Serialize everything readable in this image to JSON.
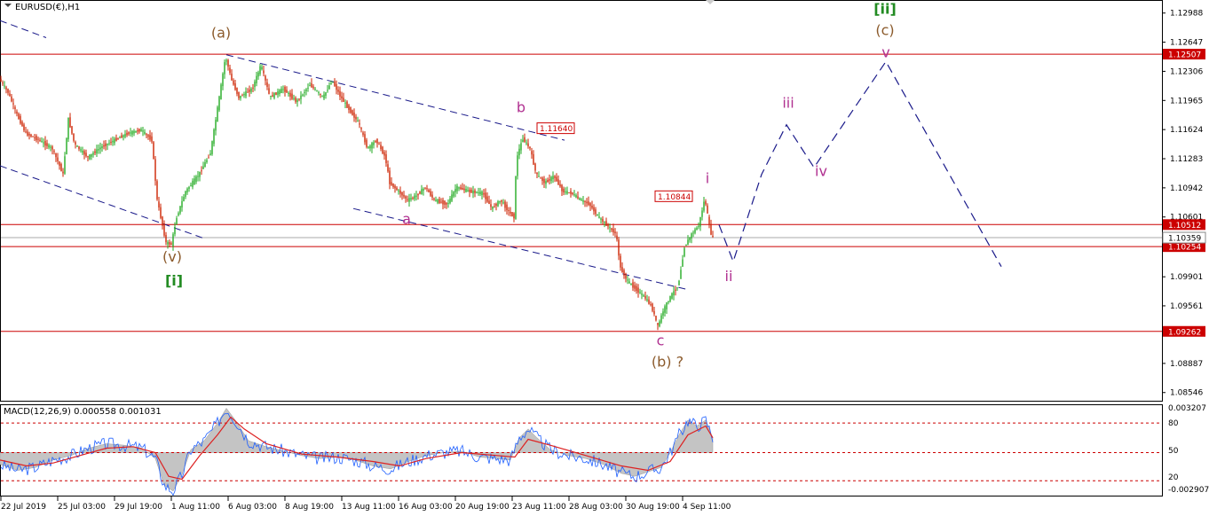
{
  "window": {
    "title": "EURUSD(€),H1"
  },
  "chart_data": [
    {
      "type": "line",
      "title": "EURUSD(€),H1",
      "ylim": [
        1.0845,
        1.1312
      ],
      "y_ticks": [
        "1.12988",
        "1.12647",
        "1.12306",
        "1.11965",
        "1.11624",
        "1.11283",
        "1.10942",
        "1.10601",
        "1.09901",
        "1.09561",
        "1.08887",
        "1.08546"
      ],
      "x_ticks": [
        "22 Jul 2019",
        "25 Jul 03:00",
        "29 Jul 19:00",
        "1 Aug 11:00",
        "6 Aug 03:00",
        "8 Aug 19:00",
        "13 Aug 11:00",
        "16 Aug 03:00",
        "20 Aug 19:00",
        "23 Aug 11:00",
        "28 Aug 03:00",
        "30 Aug 19:00",
        "4 Sep 11:00"
      ],
      "price_path": [
        [
          0,
          1.1222
        ],
        [
          10,
          1.1206
        ],
        [
          20,
          1.118
        ],
        [
          30,
          1.1158
        ],
        [
          45,
          1.115
        ],
        [
          60,
          1.114
        ],
        [
          72,
          1.111
        ],
        [
          78,
          1.1175
        ],
        [
          85,
          1.1145
        ],
        [
          100,
          1.113
        ],
        [
          115,
          1.1142
        ],
        [
          130,
          1.115
        ],
        [
          145,
          1.1158
        ],
        [
          160,
          1.1162
        ],
        [
          172,
          1.115
        ],
        [
          178,
          1.108
        ],
        [
          182,
          1.106
        ],
        [
          188,
          1.103
        ],
        [
          194,
          1.1028
        ],
        [
          200,
          1.106
        ],
        [
          210,
          1.109
        ],
        [
          225,
          1.111
        ],
        [
          238,
          1.1135
        ],
        [
          248,
          1.12
        ],
        [
          255,
          1.1248
        ],
        [
          262,
          1.122
        ],
        [
          270,
          1.12
        ],
        [
          285,
          1.121
        ],
        [
          295,
          1.1238
        ],
        [
          305,
          1.12
        ],
        [
          320,
          1.121
        ],
        [
          335,
          1.1195
        ],
        [
          350,
          1.1215
        ],
        [
          365,
          1.12
        ],
        [
          375,
          1.122
        ],
        [
          385,
          1.12
        ],
        [
          395,
          1.1185
        ],
        [
          405,
          1.117
        ],
        [
          415,
          1.114
        ],
        [
          425,
          1.115
        ],
        [
          435,
          1.113
        ],
        [
          440,
          1.11
        ],
        [
          450,
          1.109
        ],
        [
          460,
          1.108
        ],
        [
          470,
          1.1085
        ],
        [
          480,
          1.1095
        ],
        [
          490,
          1.108
        ],
        [
          505,
          1.1075
        ],
        [
          515,
          1.1095
        ],
        [
          530,
          1.109
        ],
        [
          545,
          1.1088
        ],
        [
          555,
          1.107
        ],
        [
          565,
          1.108
        ],
        [
          575,
          1.1065
        ],
        [
          580,
          1.106
        ],
        [
          583,
          1.113
        ],
        [
          590,
          1.1152
        ],
        [
          598,
          1.114
        ],
        [
          605,
          1.111
        ],
        [
          615,
          1.11
        ],
        [
          625,
          1.1108
        ],
        [
          635,
          1.109
        ],
        [
          645,
          1.1088
        ],
        [
          655,
          1.108
        ],
        [
          665,
          1.1075
        ],
        [
          675,
          1.106
        ],
        [
          685,
          1.105
        ],
        [
          695,
          1.104
        ],
        [
          700,
          1.1
        ],
        [
          708,
          1.0985
        ],
        [
          718,
          1.0975
        ],
        [
          728,
          1.0965
        ],
        [
          735,
          1.0955
        ],
        [
          742,
          1.0932
        ],
        [
          748,
          1.095
        ],
        [
          755,
          1.0965
        ],
        [
          765,
          1.098
        ],
        [
          772,
          1.1025
        ],
        [
          780,
          1.104
        ],
        [
          788,
          1.105
        ],
        [
          795,
          1.1082
        ],
        [
          800,
          1.105
        ],
        [
          803,
          1.1036
        ]
      ],
      "horizontal_levels": [
        {
          "value": 1.12507,
          "label": "1.12507",
          "color": "#cc0000"
        },
        {
          "value": 1.10512,
          "label": "1.10512",
          "color": "#cc0000"
        },
        {
          "value": 1.10254,
          "label": "1.10254",
          "color": "#cc0000"
        },
        {
          "value": 1.09262,
          "label": "1.09262",
          "color": "#cc0000"
        }
      ],
      "current_price": {
        "value": 1.10359,
        "label": "1.10359",
        "color": "#aaaaaa"
      },
      "price_boxes": [
        {
          "label": "1.11640",
          "x": 605,
          "y": 1.1164
        },
        {
          "label": "1.10844",
          "x": 738,
          "y": 1.10844
        }
      ],
      "trendlines": [
        {
          "x1": 0,
          "y1": 1.129,
          "x2": 52,
          "y2": 1.127
        },
        {
          "x1": 0,
          "y1": 1.112,
          "x2": 230,
          "y2": 1.1035
        },
        {
          "x1": 255,
          "y1": 1.125,
          "x2": 636,
          "y2": 1.115
        },
        {
          "x1": 398,
          "y1": 1.107,
          "x2": 775,
          "y2": 1.0975
        }
      ],
      "projection_path": [
        [
          810,
          1.1051
        ],
        [
          826,
          1.1008
        ],
        [
          858,
          1.111
        ],
        [
          886,
          1.1168
        ],
        [
          917,
          1.1118
        ],
        [
          998,
          1.1242
        ],
        [
          1128,
          1.1002
        ]
      ],
      "wave_labels": [
        {
          "text": "(a)",
          "x": 249,
          "y": 1.127,
          "color": "#8b5a2b"
        },
        {
          "text": "(v)",
          "x": 194,
          "y": 1.1008,
          "color": "#8b5a2b"
        },
        {
          "text": "[i]",
          "x": 196,
          "y": 1.098,
          "color": "#228b22"
        },
        {
          "text": "b",
          "x": 587,
          "y": 1.1183,
          "color": "#b03090"
        },
        {
          "text": "a",
          "x": 458,
          "y": 1.1052,
          "color": "#b03090"
        },
        {
          "text": "c",
          "x": 744,
          "y": 1.091,
          "color": "#b03090"
        },
        {
          "text": "(b) ?",
          "x": 752,
          "y": 1.0885,
          "color": "#8b5a2b"
        },
        {
          "text": "i",
          "x": 797,
          "y": 1.11,
          "color": "#b03090"
        },
        {
          "text": "ii",
          "x": 821,
          "y": 1.0985,
          "color": "#b03090"
        },
        {
          "text": "iii",
          "x": 888,
          "y": 1.1188,
          "color": "#b03090"
        },
        {
          "text": "iv",
          "x": 925,
          "y": 1.1108,
          "color": "#b03090"
        },
        {
          "text": "v",
          "x": 998,
          "y": 1.1247,
          "color": "#b03090"
        },
        {
          "text": "[ii]",
          "x": 997,
          "y": 1.1298,
          "color": "#228b22"
        },
        {
          "text": "(c)",
          "x": 997,
          "y": 1.1273,
          "color": "#8b5a2b"
        }
      ]
    },
    {
      "type": "area",
      "title": "MACD(12,26,9) 0.000558 0.001031",
      "ylim": [
        -0.002907,
        0.003207
      ],
      "y_ticks": [
        "0.003207",
        "80",
        "50",
        "20",
        "-0.002907"
      ],
      "histogram": [
        [
          0,
          -0.0008
        ],
        [
          20,
          -0.0012
        ],
        [
          40,
          -0.001
        ],
        [
          60,
          -0.0005
        ],
        [
          80,
          -0.0002
        ],
        [
          100,
          0.0003
        ],
        [
          120,
          0.0006
        ],
        [
          140,
          0.0005
        ],
        [
          160,
          0.0003
        ],
        [
          175,
          -0.0004
        ],
        [
          185,
          -0.0022
        ],
        [
          195,
          -0.0026
        ],
        [
          205,
          -0.0015
        ],
        [
          215,
          0.0002
        ],
        [
          230,
          0.0008
        ],
        [
          245,
          0.002
        ],
        [
          255,
          0.003
        ],
        [
          265,
          0.0022
        ],
        [
          280,
          0.0008
        ],
        [
          300,
          0.0004
        ],
        [
          320,
          0.0001
        ],
        [
          340,
          -0.0002
        ],
        [
          360,
          -0.0004
        ],
        [
          380,
          -0.0003
        ],
        [
          400,
          -0.0005
        ],
        [
          420,
          -0.0009
        ],
        [
          440,
          -0.0011
        ],
        [
          460,
          -0.0006
        ],
        [
          480,
          -0.0002
        ],
        [
          500,
          0.0
        ],
        [
          520,
          0.0001
        ],
        [
          540,
          -0.0003
        ],
        [
          560,
          -0.0004
        ],
        [
          575,
          -0.0005
        ],
        [
          585,
          0.001
        ],
        [
          595,
          0.0016
        ],
        [
          605,
          0.001
        ],
        [
          620,
          0.0002
        ],
        [
          640,
          -0.0002
        ],
        [
          660,
          -0.0004
        ],
        [
          680,
          -0.0008
        ],
        [
          700,
          -0.0014
        ],
        [
          715,
          -0.0016
        ],
        [
          730,
          -0.0013
        ],
        [
          745,
          -0.001
        ],
        [
          755,
          0.0
        ],
        [
          765,
          0.0012
        ],
        [
          775,
          0.0022
        ],
        [
          785,
          0.0018
        ],
        [
          795,
          0.0022
        ],
        [
          803,
          0.001
        ]
      ],
      "signal": [
        [
          0,
          -0.0005
        ],
        [
          30,
          -0.0009
        ],
        [
          60,
          -0.0007
        ],
        [
          90,
          -0.0002
        ],
        [
          120,
          0.0003
        ],
        [
          150,
          0.0004
        ],
        [
          175,
          0.0
        ],
        [
          190,
          -0.0016
        ],
        [
          205,
          -0.0018
        ],
        [
          225,
          -0.0002
        ],
        [
          245,
          0.0012
        ],
        [
          260,
          0.0024
        ],
        [
          275,
          0.0016
        ],
        [
          300,
          0.0006
        ],
        [
          340,
          -0.0001
        ],
        [
          380,
          -0.0003
        ],
        [
          420,
          -0.0006
        ],
        [
          450,
          -0.0009
        ],
        [
          480,
          -0.0004
        ],
        [
          520,
          0.0
        ],
        [
          560,
          -0.0002
        ],
        [
          580,
          -0.0003
        ],
        [
          595,
          0.0009
        ],
        [
          620,
          0.0005
        ],
        [
          660,
          -0.0002
        ],
        [
          700,
          -0.0009
        ],
        [
          730,
          -0.0012
        ],
        [
          755,
          -0.0006
        ],
        [
          775,
          0.0012
        ],
        [
          795,
          0.0018
        ],
        [
          803,
          0.001
        ]
      ],
      "dashed_levels": [
        0.002,
        0.0,
        -0.0019
      ]
    }
  ],
  "colors": {
    "bull": "#22aa22",
    "bear": "#cc2200",
    "level": "#cc0000",
    "projection": "#1a1a8a",
    "trend": "#1a1a8a",
    "macd_fill": "#c4c4c4",
    "macd_line": "#1e5fff",
    "signal_line": "#dd2222"
  }
}
